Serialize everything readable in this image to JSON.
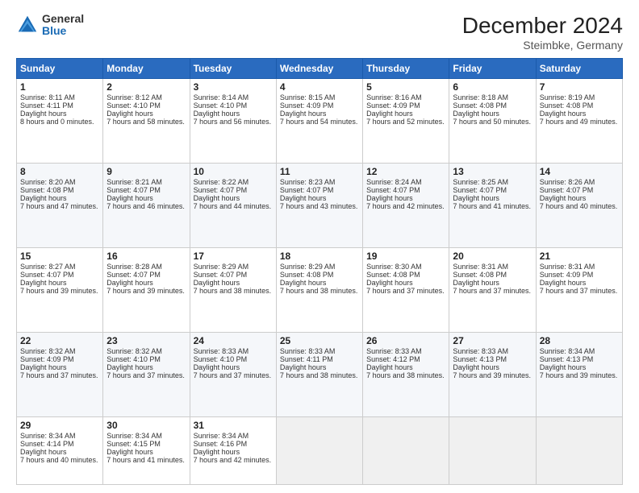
{
  "header": {
    "logo_general": "General",
    "logo_blue": "Blue",
    "title": "December 2024",
    "subtitle": "Steimbke, Germany"
  },
  "days_of_week": [
    "Sunday",
    "Monday",
    "Tuesday",
    "Wednesday",
    "Thursday",
    "Friday",
    "Saturday"
  ],
  "weeks": [
    [
      {
        "day": 1,
        "sunrise": "8:11 AM",
        "sunset": "4:11 PM",
        "daylight": "8 hours and 0 minutes."
      },
      {
        "day": 2,
        "sunrise": "8:12 AM",
        "sunset": "4:10 PM",
        "daylight": "7 hours and 58 minutes."
      },
      {
        "day": 3,
        "sunrise": "8:14 AM",
        "sunset": "4:10 PM",
        "daylight": "7 hours and 56 minutes."
      },
      {
        "day": 4,
        "sunrise": "8:15 AM",
        "sunset": "4:09 PM",
        "daylight": "7 hours and 54 minutes."
      },
      {
        "day": 5,
        "sunrise": "8:16 AM",
        "sunset": "4:09 PM",
        "daylight": "7 hours and 52 minutes."
      },
      {
        "day": 6,
        "sunrise": "8:18 AM",
        "sunset": "4:08 PM",
        "daylight": "7 hours and 50 minutes."
      },
      {
        "day": 7,
        "sunrise": "8:19 AM",
        "sunset": "4:08 PM",
        "daylight": "7 hours and 49 minutes."
      }
    ],
    [
      {
        "day": 8,
        "sunrise": "8:20 AM",
        "sunset": "4:08 PM",
        "daylight": "7 hours and 47 minutes."
      },
      {
        "day": 9,
        "sunrise": "8:21 AM",
        "sunset": "4:07 PM",
        "daylight": "7 hours and 46 minutes."
      },
      {
        "day": 10,
        "sunrise": "8:22 AM",
        "sunset": "4:07 PM",
        "daylight": "7 hours and 44 minutes."
      },
      {
        "day": 11,
        "sunrise": "8:23 AM",
        "sunset": "4:07 PM",
        "daylight": "7 hours and 43 minutes."
      },
      {
        "day": 12,
        "sunrise": "8:24 AM",
        "sunset": "4:07 PM",
        "daylight": "7 hours and 42 minutes."
      },
      {
        "day": 13,
        "sunrise": "8:25 AM",
        "sunset": "4:07 PM",
        "daylight": "7 hours and 41 minutes."
      },
      {
        "day": 14,
        "sunrise": "8:26 AM",
        "sunset": "4:07 PM",
        "daylight": "7 hours and 40 minutes."
      }
    ],
    [
      {
        "day": 15,
        "sunrise": "8:27 AM",
        "sunset": "4:07 PM",
        "daylight": "7 hours and 39 minutes."
      },
      {
        "day": 16,
        "sunrise": "8:28 AM",
        "sunset": "4:07 PM",
        "daylight": "7 hours and 39 minutes."
      },
      {
        "day": 17,
        "sunrise": "8:29 AM",
        "sunset": "4:07 PM",
        "daylight": "7 hours and 38 minutes."
      },
      {
        "day": 18,
        "sunrise": "8:29 AM",
        "sunset": "4:08 PM",
        "daylight": "7 hours and 38 minutes."
      },
      {
        "day": 19,
        "sunrise": "8:30 AM",
        "sunset": "4:08 PM",
        "daylight": "7 hours and 37 minutes."
      },
      {
        "day": 20,
        "sunrise": "8:31 AM",
        "sunset": "4:08 PM",
        "daylight": "7 hours and 37 minutes."
      },
      {
        "day": 21,
        "sunrise": "8:31 AM",
        "sunset": "4:09 PM",
        "daylight": "7 hours and 37 minutes."
      }
    ],
    [
      {
        "day": 22,
        "sunrise": "8:32 AM",
        "sunset": "4:09 PM",
        "daylight": "7 hours and 37 minutes."
      },
      {
        "day": 23,
        "sunrise": "8:32 AM",
        "sunset": "4:10 PM",
        "daylight": "7 hours and 37 minutes."
      },
      {
        "day": 24,
        "sunrise": "8:33 AM",
        "sunset": "4:10 PM",
        "daylight": "7 hours and 37 minutes."
      },
      {
        "day": 25,
        "sunrise": "8:33 AM",
        "sunset": "4:11 PM",
        "daylight": "7 hours and 38 minutes."
      },
      {
        "day": 26,
        "sunrise": "8:33 AM",
        "sunset": "4:12 PM",
        "daylight": "7 hours and 38 minutes."
      },
      {
        "day": 27,
        "sunrise": "8:33 AM",
        "sunset": "4:13 PM",
        "daylight": "7 hours and 39 minutes."
      },
      {
        "day": 28,
        "sunrise": "8:34 AM",
        "sunset": "4:13 PM",
        "daylight": "7 hours and 39 minutes."
      }
    ],
    [
      {
        "day": 29,
        "sunrise": "8:34 AM",
        "sunset": "4:14 PM",
        "daylight": "7 hours and 40 minutes."
      },
      {
        "day": 30,
        "sunrise": "8:34 AM",
        "sunset": "4:15 PM",
        "daylight": "7 hours and 41 minutes."
      },
      {
        "day": 31,
        "sunrise": "8:34 AM",
        "sunset": "4:16 PM",
        "daylight": "7 hours and 42 minutes."
      },
      null,
      null,
      null,
      null
    ]
  ]
}
